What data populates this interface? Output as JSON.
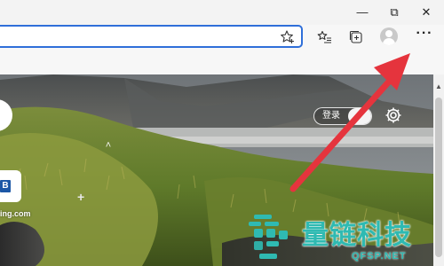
{
  "window": {
    "minimize_icon": "minimize-icon",
    "restore_icon": "restore-icon",
    "close_icon": "close-icon",
    "minimize_glyph": "—",
    "restore_glyph": "⧉",
    "close_glyph": "✕"
  },
  "address_bar": {
    "value": "",
    "placeholder": "",
    "favorite_icon": "star-plus-icon"
  },
  "toolbar": {
    "favorites_icon": "favorites-list-icon",
    "collections_icon": "collections-icon",
    "profile_icon": "profile-avatar-icon",
    "more_label": "···"
  },
  "page": {
    "login_label": "登录",
    "settings_icon": "gear-icon",
    "tile_letter": "B",
    "tile_caption": "ing.com",
    "chevron_glyph": "˄",
    "plus_glyph": "+"
  },
  "watermark": {
    "name": "量链科技",
    "domain": "QFSP.NET"
  },
  "colors": {
    "accent": "#2f6fd9",
    "arrow": "#e5343d",
    "watermark": "#2fbab2",
    "tile_blue": "#1c57a6"
  }
}
